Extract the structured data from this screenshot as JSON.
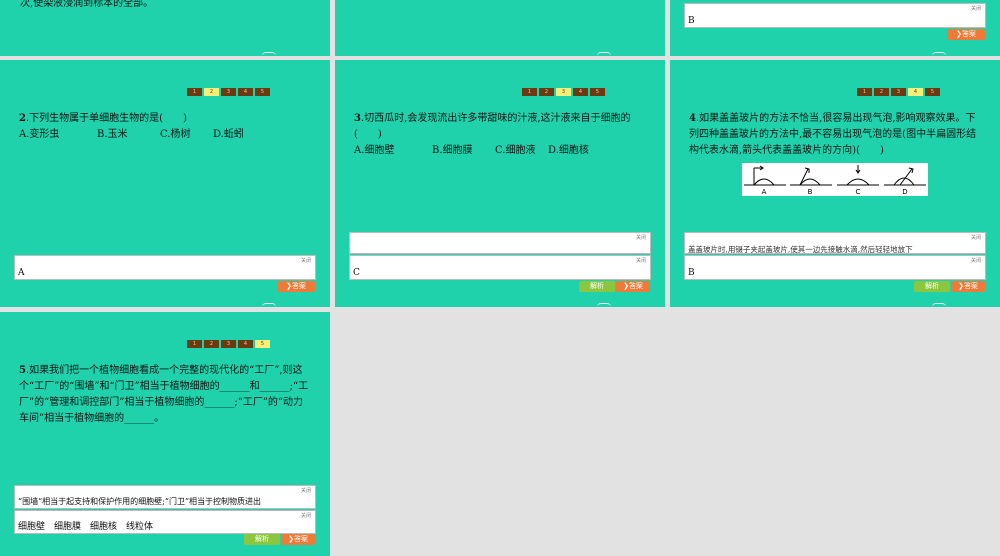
{
  "common": {
    "close": "关闭",
    "answer_btn": "答案",
    "analysis_btn": "解析",
    "chevron": "❯"
  },
  "slide1": {
    "text": "次,使染液浸润到标本的全部。"
  },
  "slide3": {
    "answer": "B"
  },
  "pages": [
    "1",
    "2",
    "3",
    "4",
    "5"
  ],
  "q2": {
    "num": "2",
    "text": ".下列生物属于单细胞生物的是(　　)",
    "options": [
      "A.变形虫",
      "B.玉米",
      "C.杨树",
      "D.蚯蚓"
    ],
    "answer": "A"
  },
  "q3": {
    "num": "3",
    "text": ".切西瓜时,会发现流出许多带甜味的汁液,这汁液来自于细胞的(　　)",
    "options": [
      "A.细胞壁",
      "B.细胞膜",
      "C.细胞液",
      "D.细胞核"
    ],
    "answer": "C"
  },
  "q4": {
    "num": "4",
    "text": ".如果盖盖玻片的方法不恰当,很容易出现气泡,影响观察效果。下列四种盖盖玻片的方法中,最不容易出现气泡的是(图中半扁圆形结构代表水滴,箭头代表盖盖玻片的方向)(　　)",
    "labels": [
      "A",
      "B",
      "C",
      "D"
    ],
    "explain": "盖盖玻片时,用镊子夹起盖玻片,使其一边先接触水滴,然后轻轻地放下",
    "answer": "B"
  },
  "q5": {
    "num": "5",
    "text": ".如果我们把一个植物细胞看成一个完整的现代化的“工厂”,则这个“工厂”的“围墙”和“门卫”相当于植物细胞的______和______;“工厂”的“管理和调控部门”相当于植物细胞的______;“工厂”的“动力车间”相当于植物细胞的______。",
    "explain": "“围墙”相当于起支持和保护作用的细胞壁;“门卫”相当于控制物质进出",
    "answer": "细胞壁　细胞膜　细胞核　线粒体"
  }
}
